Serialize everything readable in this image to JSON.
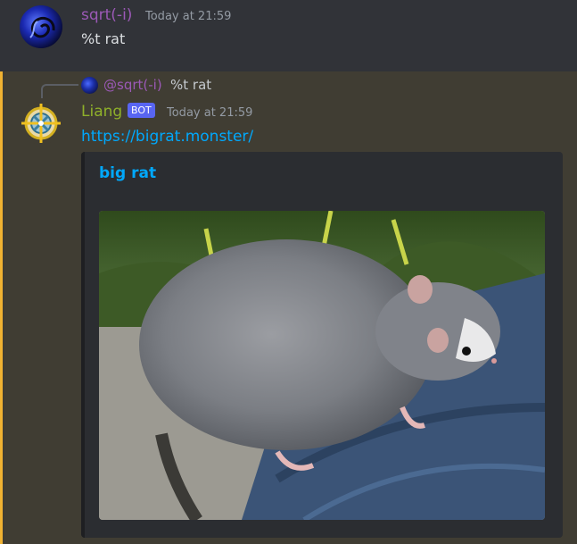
{
  "messages": [
    {
      "author": "sqrt(-i)",
      "author_color": "#9b59b6",
      "timestamp": "Today at 21:59",
      "content": "%t rat",
      "avatar_icon": "spiral-galaxy-avatar"
    },
    {
      "reply": {
        "mention": "@sqrt(-i)",
        "text": "%t rat"
      },
      "author": "Liang",
      "author_color": "#8fb02a",
      "badge": "BOT",
      "timestamp": "Today at 21:59",
      "link": "https://bigrat.monster/",
      "avatar_icon": "compass-target-avatar",
      "embed": {
        "title": "big rat",
        "image": "big-rat-photo"
      }
    }
  ],
  "colors": {
    "background": "#313338",
    "mention_highlight": "#403d33",
    "mention_bar": "#f0b232",
    "embed_bg": "#2b2d31",
    "link": "#00a8fc",
    "bot_badge": "#5865f2"
  }
}
